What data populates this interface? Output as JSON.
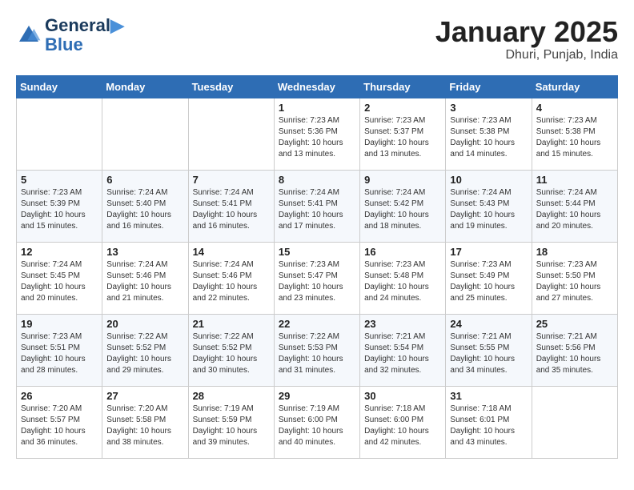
{
  "header": {
    "logo_line1": "General",
    "logo_line2": "Blue",
    "month_title": "January 2025",
    "location": "Dhuri, Punjab, India"
  },
  "weekdays": [
    "Sunday",
    "Monday",
    "Tuesday",
    "Wednesday",
    "Thursday",
    "Friday",
    "Saturday"
  ],
  "weeks": [
    [
      {
        "day": "",
        "sunrise": "",
        "sunset": "",
        "daylight": ""
      },
      {
        "day": "",
        "sunrise": "",
        "sunset": "",
        "daylight": ""
      },
      {
        "day": "",
        "sunrise": "",
        "sunset": "",
        "daylight": ""
      },
      {
        "day": "1",
        "sunrise": "Sunrise: 7:23 AM",
        "sunset": "Sunset: 5:36 PM",
        "daylight": "Daylight: 10 hours and 13 minutes."
      },
      {
        "day": "2",
        "sunrise": "Sunrise: 7:23 AM",
        "sunset": "Sunset: 5:37 PM",
        "daylight": "Daylight: 10 hours and 13 minutes."
      },
      {
        "day": "3",
        "sunrise": "Sunrise: 7:23 AM",
        "sunset": "Sunset: 5:38 PM",
        "daylight": "Daylight: 10 hours and 14 minutes."
      },
      {
        "day": "4",
        "sunrise": "Sunrise: 7:23 AM",
        "sunset": "Sunset: 5:38 PM",
        "daylight": "Daylight: 10 hours and 15 minutes."
      }
    ],
    [
      {
        "day": "5",
        "sunrise": "Sunrise: 7:23 AM",
        "sunset": "Sunset: 5:39 PM",
        "daylight": "Daylight: 10 hours and 15 minutes."
      },
      {
        "day": "6",
        "sunrise": "Sunrise: 7:24 AM",
        "sunset": "Sunset: 5:40 PM",
        "daylight": "Daylight: 10 hours and 16 minutes."
      },
      {
        "day": "7",
        "sunrise": "Sunrise: 7:24 AM",
        "sunset": "Sunset: 5:41 PM",
        "daylight": "Daylight: 10 hours and 16 minutes."
      },
      {
        "day": "8",
        "sunrise": "Sunrise: 7:24 AM",
        "sunset": "Sunset: 5:41 PM",
        "daylight": "Daylight: 10 hours and 17 minutes."
      },
      {
        "day": "9",
        "sunrise": "Sunrise: 7:24 AM",
        "sunset": "Sunset: 5:42 PM",
        "daylight": "Daylight: 10 hours and 18 minutes."
      },
      {
        "day": "10",
        "sunrise": "Sunrise: 7:24 AM",
        "sunset": "Sunset: 5:43 PM",
        "daylight": "Daylight: 10 hours and 19 minutes."
      },
      {
        "day": "11",
        "sunrise": "Sunrise: 7:24 AM",
        "sunset": "Sunset: 5:44 PM",
        "daylight": "Daylight: 10 hours and 20 minutes."
      }
    ],
    [
      {
        "day": "12",
        "sunrise": "Sunrise: 7:24 AM",
        "sunset": "Sunset: 5:45 PM",
        "daylight": "Daylight: 10 hours and 20 minutes."
      },
      {
        "day": "13",
        "sunrise": "Sunrise: 7:24 AM",
        "sunset": "Sunset: 5:46 PM",
        "daylight": "Daylight: 10 hours and 21 minutes."
      },
      {
        "day": "14",
        "sunrise": "Sunrise: 7:24 AM",
        "sunset": "Sunset: 5:46 PM",
        "daylight": "Daylight: 10 hours and 22 minutes."
      },
      {
        "day": "15",
        "sunrise": "Sunrise: 7:23 AM",
        "sunset": "Sunset: 5:47 PM",
        "daylight": "Daylight: 10 hours and 23 minutes."
      },
      {
        "day": "16",
        "sunrise": "Sunrise: 7:23 AM",
        "sunset": "Sunset: 5:48 PM",
        "daylight": "Daylight: 10 hours and 24 minutes."
      },
      {
        "day": "17",
        "sunrise": "Sunrise: 7:23 AM",
        "sunset": "Sunset: 5:49 PM",
        "daylight": "Daylight: 10 hours and 25 minutes."
      },
      {
        "day": "18",
        "sunrise": "Sunrise: 7:23 AM",
        "sunset": "Sunset: 5:50 PM",
        "daylight": "Daylight: 10 hours and 27 minutes."
      }
    ],
    [
      {
        "day": "19",
        "sunrise": "Sunrise: 7:23 AM",
        "sunset": "Sunset: 5:51 PM",
        "daylight": "Daylight: 10 hours and 28 minutes."
      },
      {
        "day": "20",
        "sunrise": "Sunrise: 7:22 AM",
        "sunset": "Sunset: 5:52 PM",
        "daylight": "Daylight: 10 hours and 29 minutes."
      },
      {
        "day": "21",
        "sunrise": "Sunrise: 7:22 AM",
        "sunset": "Sunset: 5:52 PM",
        "daylight": "Daylight: 10 hours and 30 minutes."
      },
      {
        "day": "22",
        "sunrise": "Sunrise: 7:22 AM",
        "sunset": "Sunset: 5:53 PM",
        "daylight": "Daylight: 10 hours and 31 minutes."
      },
      {
        "day": "23",
        "sunrise": "Sunrise: 7:21 AM",
        "sunset": "Sunset: 5:54 PM",
        "daylight": "Daylight: 10 hours and 32 minutes."
      },
      {
        "day": "24",
        "sunrise": "Sunrise: 7:21 AM",
        "sunset": "Sunset: 5:55 PM",
        "daylight": "Daylight: 10 hours and 34 minutes."
      },
      {
        "day": "25",
        "sunrise": "Sunrise: 7:21 AM",
        "sunset": "Sunset: 5:56 PM",
        "daylight": "Daylight: 10 hours and 35 minutes."
      }
    ],
    [
      {
        "day": "26",
        "sunrise": "Sunrise: 7:20 AM",
        "sunset": "Sunset: 5:57 PM",
        "daylight": "Daylight: 10 hours and 36 minutes."
      },
      {
        "day": "27",
        "sunrise": "Sunrise: 7:20 AM",
        "sunset": "Sunset: 5:58 PM",
        "daylight": "Daylight: 10 hours and 38 minutes."
      },
      {
        "day": "28",
        "sunrise": "Sunrise: 7:19 AM",
        "sunset": "Sunset: 5:59 PM",
        "daylight": "Daylight: 10 hours and 39 minutes."
      },
      {
        "day": "29",
        "sunrise": "Sunrise: 7:19 AM",
        "sunset": "Sunset: 6:00 PM",
        "daylight": "Daylight: 10 hours and 40 minutes."
      },
      {
        "day": "30",
        "sunrise": "Sunrise: 7:18 AM",
        "sunset": "Sunset: 6:00 PM",
        "daylight": "Daylight: 10 hours and 42 minutes."
      },
      {
        "day": "31",
        "sunrise": "Sunrise: 7:18 AM",
        "sunset": "Sunset: 6:01 PM",
        "daylight": "Daylight: 10 hours and 43 minutes."
      },
      {
        "day": "",
        "sunrise": "",
        "sunset": "",
        "daylight": ""
      }
    ]
  ]
}
